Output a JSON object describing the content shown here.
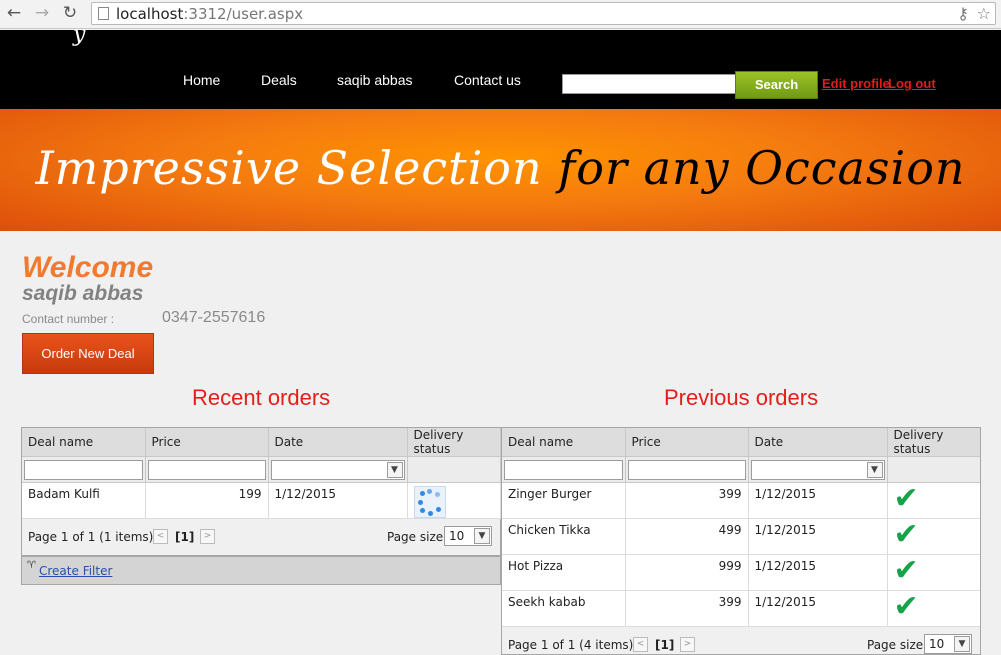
{
  "browser": {
    "url_host": "localhost",
    "url_rest": ":3312/user.aspx"
  },
  "nav": {
    "items": [
      "Home",
      "Deals",
      "saqib abbas",
      "Contact us"
    ],
    "search_label": "Search",
    "search_value": "",
    "edit_profile": "Edit profile",
    "logout": "Log out"
  },
  "banner": {
    "white_text": "Impressive Selection",
    "black_text": "for any Occasion"
  },
  "profile": {
    "welcome": "Welcome",
    "name": "saqib abbas",
    "contact_label": "Contact number :",
    "contact_value": "0347-2557616",
    "order_button": "Order New Deal"
  },
  "recent": {
    "title": "Recent orders",
    "columns": [
      "Deal name",
      "Price",
      "Date",
      "Delivery status"
    ],
    "rows": [
      {
        "name": "Badam Kulfi",
        "price": "199",
        "date": "1/12/2015",
        "status": "loading"
      }
    ],
    "pager": {
      "summary": "Page 1 of 1 (1 items)",
      "current": "[1]",
      "size_label": "Page size:",
      "size": "10"
    },
    "create_filter": "Create Filter"
  },
  "previous": {
    "title": "Previous orders",
    "columns": [
      "Deal name",
      "Price",
      "Date",
      "Delivery status"
    ],
    "rows": [
      {
        "name": "Zinger Burger",
        "price": "399",
        "date": "1/12/2015",
        "status": "delivered"
      },
      {
        "name": "Chicken Tikka",
        "price": "499",
        "date": "1/12/2015",
        "status": "delivered"
      },
      {
        "name": "Hot Pizza",
        "price": "999",
        "date": "1/12/2015",
        "status": "delivered"
      },
      {
        "name": "Seekh kabab",
        "price": "399",
        "date": "1/12/2015",
        "status": "delivered"
      }
    ],
    "pager": {
      "summary": "Page 1 of 1 (4 items)",
      "current": "[1]",
      "size_label": "Page size:",
      "size": "10"
    }
  },
  "colors": {
    "accent_red": "#e51d1d",
    "welcome_orange": "#f07a30",
    "check_green": "#16a34a",
    "search_green": "#8cb420"
  }
}
